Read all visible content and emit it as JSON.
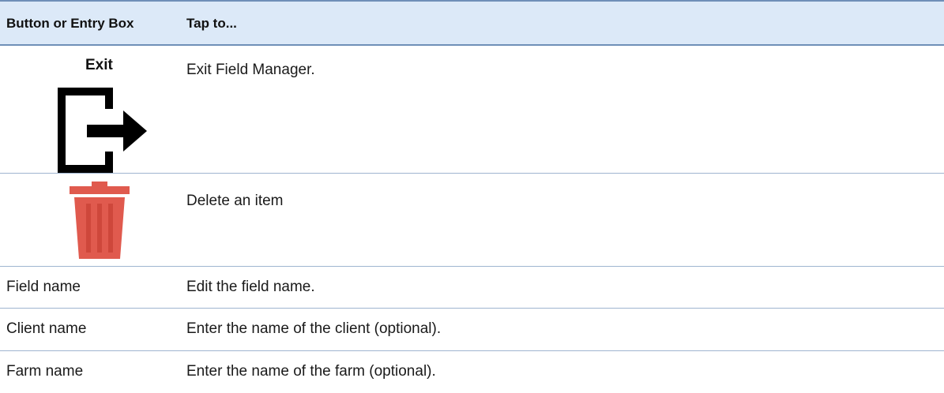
{
  "table": {
    "headers": {
      "col1": "Button or Entry Box",
      "col2": "Tap to..."
    },
    "rows": [
      {
        "label": "Exit",
        "icon": "exit-icon",
        "description": "Exit Field Manager."
      },
      {
        "label": "",
        "icon": "trash-icon",
        "description": "Delete an item"
      },
      {
        "label": "Field name",
        "description": "Edit the field name."
      },
      {
        "label": "Client name",
        "description": "Enter the name of the client (optional)."
      },
      {
        "label": "Farm name",
        "description": "Enter the name of the farm (optional)."
      }
    ]
  },
  "colors": {
    "header_bg": "#dce9f8",
    "header_border": "#6f8fb8",
    "row_border": "#9fb5d0",
    "trash_red": "#e05a4e"
  }
}
